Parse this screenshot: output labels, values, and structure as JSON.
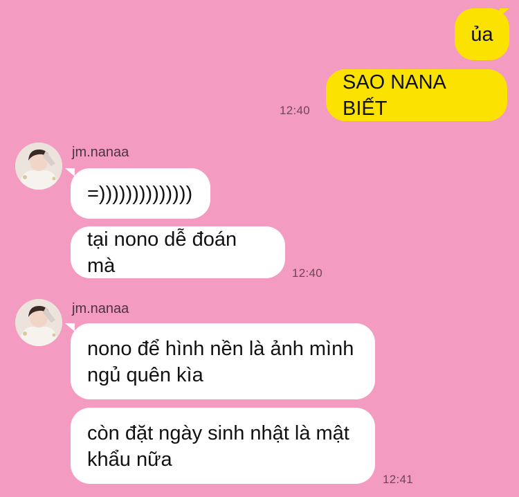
{
  "colors": {
    "background": "#f49bc1",
    "my_bubble": "#fbe200",
    "their_bubble": "#ffffff"
  },
  "outgoing": {
    "msg1": "ủa",
    "msg2": "SAO NANA BIẾT",
    "time": "12:40"
  },
  "group1": {
    "sender": "jm.nanaa",
    "avatar_icon": "profile-photo",
    "msg1": "=))))))))))))))",
    "msg2": "tại nono dễ đoán mà",
    "time": "12:40"
  },
  "group2": {
    "sender": "jm.nanaa",
    "avatar_icon": "profile-photo",
    "msg1_line1": "nono để hình nền là ảnh mình",
    "msg1_line2": "ngủ quên kìa",
    "msg2_line1": "còn đặt ngày sinh nhật là mật",
    "msg2_line2": "khẩu nữa",
    "time": "12:41"
  }
}
